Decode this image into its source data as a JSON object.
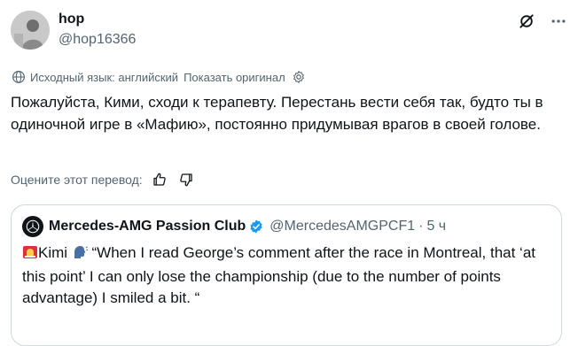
{
  "author": {
    "name": "hop",
    "handle": "@hop16366"
  },
  "translation": {
    "source_note": "Исходный язык: английский",
    "show_original": "Показать оригинал"
  },
  "tweet_text": "Пожалуйста, Кими, сходи к терапевту. Перестань вести себя так, будто ты в одиночной игре в «Мафию», постоянно придумывая врагов в своей голове.",
  "rate_prompt": "Оцените этот перевод:",
  "quote": {
    "name": "Mercedes-AMG Passion Club",
    "handle": "@MercedesAMGPCF1",
    "separator": "·",
    "time": "5 ч",
    "text_after_emoji": "Kimi",
    "text": " “When I read George’s comment after the race in Montreal, that ‘at this point’ I can only lose the championship (due to the number of points advantage) I smiled a bit. “"
  },
  "colors": {
    "text": "#0f1419",
    "secondary": "#536471",
    "border": "#cfd9de",
    "verified": "#1d9bf0"
  },
  "icons": [
    "grok-icon",
    "more-icon",
    "globe-icon",
    "gear-icon",
    "thumb-up-icon",
    "thumb-down-icon",
    "verified-icon",
    "siren-emoji",
    "speaking-head-emoji"
  ]
}
